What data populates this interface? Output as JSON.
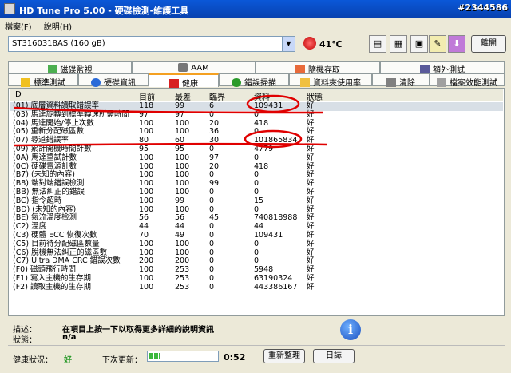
{
  "app": {
    "title": "HD Tune Pro  5.00 - 硬碟檢測-維護工具",
    "watermark": "#2344586"
  },
  "menu": [
    "檔案(F)",
    "說明(H)"
  ],
  "toolbar": {
    "drive": "ST3160318AS (160 gB)",
    "temperature": "41℃",
    "exit_label": "離開"
  },
  "tabs_top": [
    "磁碟監視",
    "AAM",
    "隨機存取",
    "額外測試"
  ],
  "tabs_bottom": [
    "標準測試",
    "硬碟資訊",
    "健康",
    "錯誤掃描",
    "資料夾使用率",
    "清除",
    "檔案效能測試"
  ],
  "table": {
    "headers": [
      "ID",
      "目前",
      "最差",
      "臨界",
      "資料",
      "狀態"
    ],
    "rows": [
      [
        "(01) 底層資料讀取錯誤率",
        "118",
        "99",
        "6",
        "109431",
        "好"
      ],
      [
        "(03) 馬達旋轉到標準轉速所需時間",
        "97",
        "97",
        "0",
        "0",
        "好"
      ],
      [
        "(04) 馬達開始/停止次數",
        "100",
        "100",
        "20",
        "418",
        "好"
      ],
      [
        "(05) 重新分配磁區數",
        "100",
        "100",
        "36",
        "0",
        "好"
      ],
      [
        "(07) 尋道錯誤率",
        "80",
        "60",
        "30",
        "101865834",
        "好"
      ],
      [
        "(09) 累計開機時間計數",
        "95",
        "95",
        "0",
        "4779",
        "好"
      ],
      [
        "(0A) 馬達重試計數",
        "100",
        "100",
        "97",
        "0",
        "好"
      ],
      [
        "(0C) 硬碟電源計數",
        "100",
        "100",
        "20",
        "418",
        "好"
      ],
      [
        "(B7) (未知的內容)",
        "100",
        "100",
        "0",
        "0",
        "好"
      ],
      [
        "(B8) 端對端錯誤檢測",
        "100",
        "100",
        "99",
        "0",
        "好"
      ],
      [
        "(BB) 無法糾正的錯誤",
        "100",
        "100",
        "0",
        "0",
        "好"
      ],
      [
        "(BC) 指令超時",
        "100",
        "99",
        "0",
        "15",
        "好"
      ],
      [
        "(BD) (未知的內容)",
        "100",
        "100",
        "0",
        "0",
        "好"
      ],
      [
        "(BE) 氣流溫度檢測",
        "56",
        "56",
        "45",
        "740818988",
        "好"
      ],
      [
        "(C2) 溫度",
        "44",
        "44",
        "0",
        "44",
        "好"
      ],
      [
        "(C3) 硬體 ECC 恢復次數",
        "70",
        "49",
        "0",
        "109431",
        "好"
      ],
      [
        "(C5) 目前待分配磁區數量",
        "100",
        "100",
        "0",
        "0",
        "好"
      ],
      [
        "(C6) 脫機無法糾正的磁區數",
        "100",
        "100",
        "0",
        "0",
        "好"
      ],
      [
        "(C7) Ultra DMA CRC 錯誤次數",
        "200",
        "200",
        "0",
        "0",
        "好"
      ],
      [
        "(F0) 磁頭飛行時間",
        "100",
        "253",
        "0",
        "5948",
        "好"
      ],
      [
        "(F1) 寫入主機的生存期",
        "100",
        "253",
        "0",
        "63190324",
        "好"
      ],
      [
        "(F2) 讀取主機的生存期",
        "100",
        "253",
        "0",
        "443386167",
        "好"
      ]
    ]
  },
  "footer": {
    "desc_label": "描述：",
    "desc_text": "在項目上按一下以取得更多詳細的說明資訊",
    "status_label": "狀態：",
    "status_text": "n/a",
    "health_label": "健康狀況：",
    "health_value": "好",
    "next_label": "下次更新：",
    "countdown": "0:52",
    "progress": 0.15,
    "refresh_label": "重新整理",
    "log_label": "日誌"
  },
  "colors": {
    "titlebar": "#0a58d8",
    "annotation": "#e00000",
    "health_ok": "#2a9a2a"
  },
  "icons": [
    "app-icon",
    "temperature-icon",
    "copy-icon",
    "copy2-icon",
    "save-icon",
    "tools-icon",
    "download-icon",
    "info-icon"
  ]
}
